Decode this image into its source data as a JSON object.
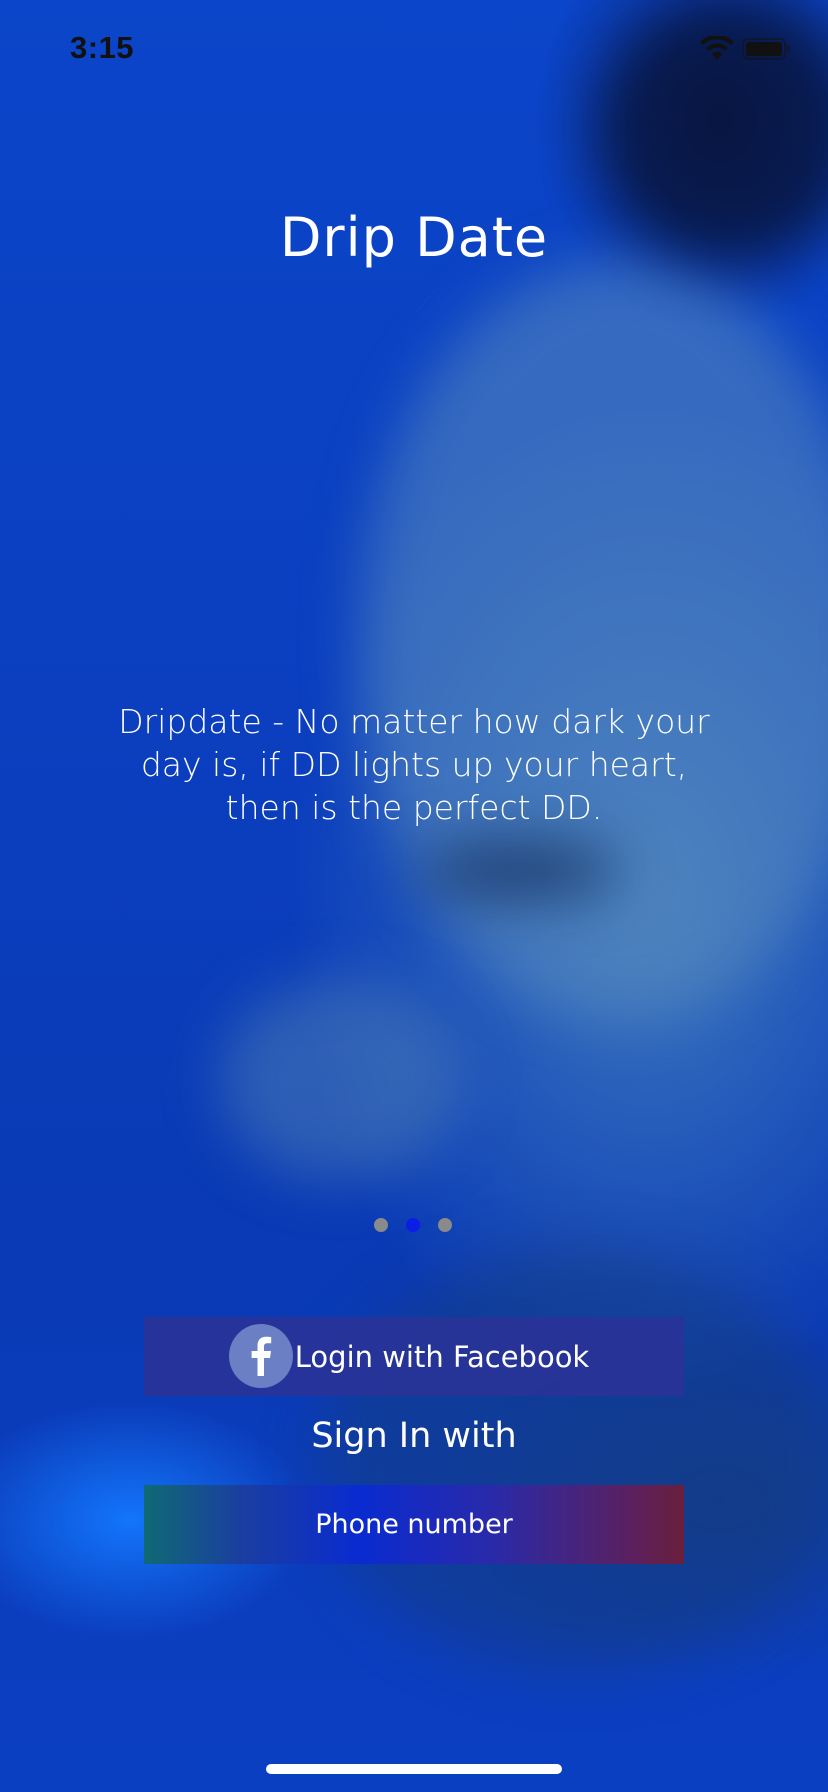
{
  "status_bar": {
    "time": "3:15"
  },
  "app": {
    "title": "Drip Date",
    "tagline": "Dripdate - No matter how dark your day is, if DD lights up your heart, then is the perfect DD."
  },
  "pager": {
    "pages": 3,
    "active_index": 1,
    "active_color": "#0a1ee6",
    "inactive_color": "#8a8a8a"
  },
  "auth": {
    "facebook_label": "Login with Facebook",
    "signin_label": "Sign In with",
    "phone_label": "Phone number"
  },
  "icons": {
    "facebook": "facebook-icon",
    "wifi": "wifi-icon",
    "battery": "battery-icon"
  },
  "colors": {
    "background": "#0b45c9",
    "facebook_button": "#2a3296",
    "text": "#ffffff"
  }
}
